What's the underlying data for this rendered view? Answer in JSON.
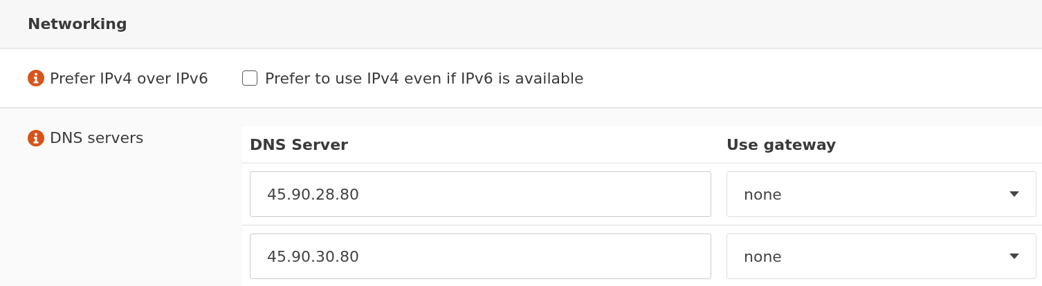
{
  "section": {
    "title": "Networking"
  },
  "prefer_ipv4": {
    "label": "Prefer IPv4 over IPv6",
    "checkbox_label": "Prefer to use IPv4 even if IPv6 is available",
    "checked": false
  },
  "dns": {
    "label": "DNS servers",
    "columns": [
      "DNS Server",
      "Use gateway"
    ],
    "rows": [
      {
        "server": "45.90.28.80",
        "gateway": "none"
      },
      {
        "server": "45.90.30.80",
        "gateway": "none"
      }
    ]
  }
}
